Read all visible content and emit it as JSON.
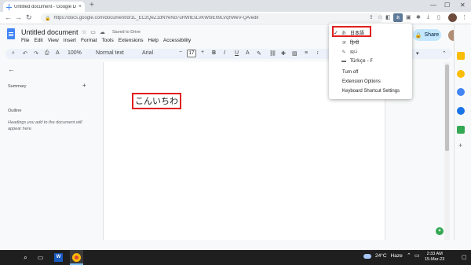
{
  "browser": {
    "tab_title": "Untitled document - Google Do",
    "tab_close": "×",
    "new_tab": "+",
    "url": "https://docs.google.com/document/d/1L_ECzQeZ1dNYeNd7uRWlEsLvKWi9Eh9LVqhWeV-QA/edit"
  },
  "docs": {
    "title": "Untitled document",
    "saved_status": "Saved to Drive",
    "menu": [
      "File",
      "Edit",
      "View",
      "Insert",
      "Format",
      "Tools",
      "Extensions",
      "Help",
      "Accessibility"
    ],
    "share_label": "Share",
    "toolbar": {
      "zoom": "100%",
      "style": "Normal text",
      "font": "Arial",
      "font_size": "17",
      "bold": "B",
      "italic": "I",
      "underline": "U",
      "minus": "−",
      "plus": "+"
    }
  },
  "outline_panel": {
    "summary_label": "Summary",
    "summary_add": "+",
    "outline_label": "Outline",
    "outline_hint": "Headings you add to the document will appear here."
  },
  "document": {
    "body_text": "こんいちわ"
  },
  "input_tools_menu": {
    "items": [
      {
        "check": "✓",
        "icon": "あ",
        "label": "日本語"
      },
      {
        "check": "",
        "icon": "अ",
        "label": "हिन्दी"
      },
      {
        "check": "",
        "icon": "✎",
        "label": "ஜப்"
      },
      {
        "check": "",
        "icon": "▬",
        "label": "Türkçe - F"
      }
    ],
    "links": [
      "Turn off",
      "Extension Options",
      "Keyboard Shortcut Settings"
    ]
  },
  "taskbar": {
    "weather_temp": "24°C",
    "weather_desc": "Haze",
    "time": "2:33 AM",
    "date": "15-Mar-23",
    "word_label": "W"
  }
}
